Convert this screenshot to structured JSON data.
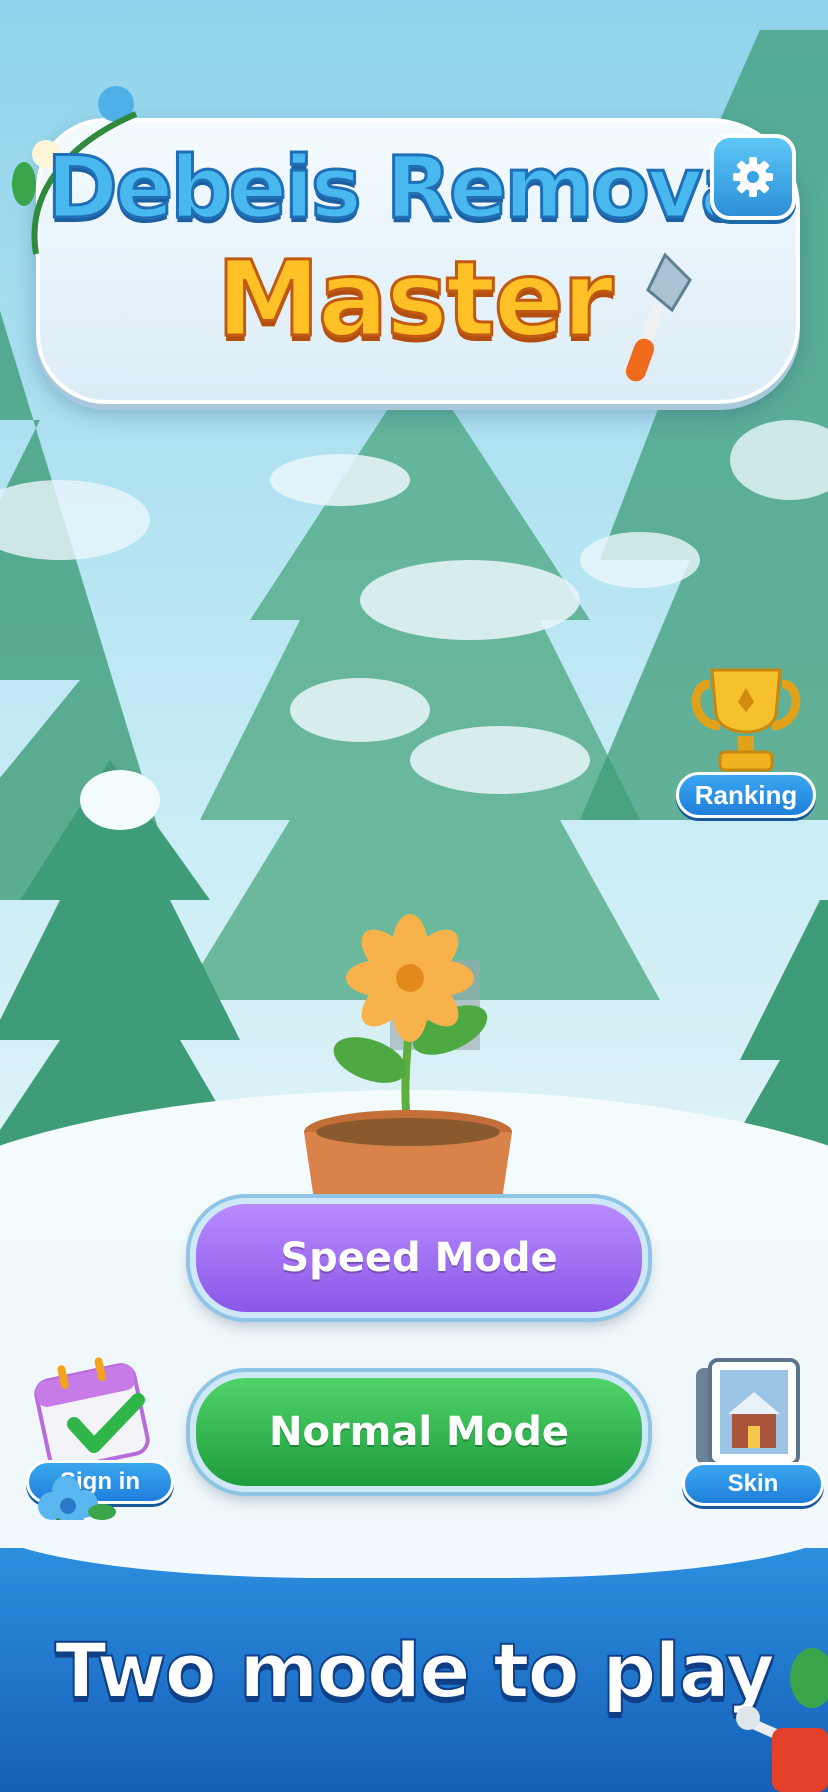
{
  "game": {
    "title_line1": "Debeis Removal",
    "title_line2": "Master"
  },
  "buttons": {
    "settings_icon": "gear-icon",
    "ranking_label": "Ranking",
    "speed_mode_label": "Speed Mode",
    "normal_mode_label": "Normal Mode",
    "sign_in_label": "Sign in",
    "skin_label": "Skin"
  },
  "banner": {
    "text": "Two mode to play"
  },
  "colors": {
    "speed_mode": "#8a57e8",
    "normal_mode": "#1f9c3c",
    "title_blue": "#49b8ef",
    "title_orange": "#ffc126",
    "banner": "#1f7fdc"
  }
}
